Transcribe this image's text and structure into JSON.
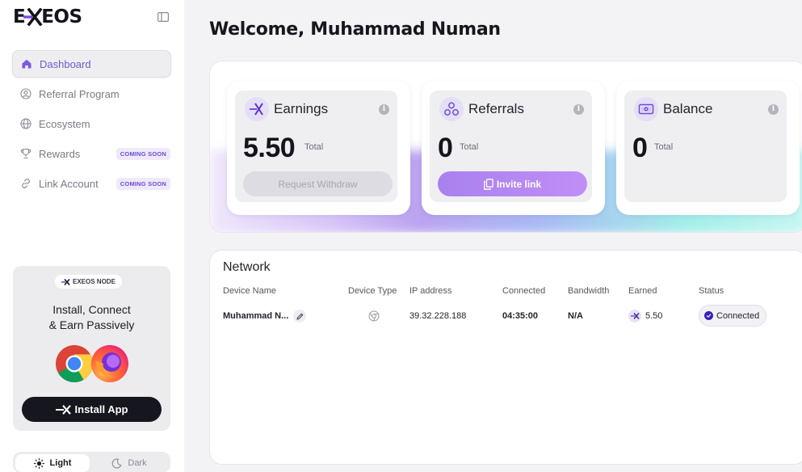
{
  "sidebar": {
    "logo": {
      "prefix": "E",
      "suffix": "EOS"
    },
    "items": [
      {
        "label": "Dashboard",
        "icon": "home-icon",
        "active": true
      },
      {
        "label": "Referral Program",
        "icon": "user-circle-icon"
      },
      {
        "label": "Ecosystem",
        "icon": "globe-icon"
      },
      {
        "label": "Rewards",
        "icon": "trophy-icon",
        "badge": "COMING SOON"
      },
      {
        "label": "Link Account",
        "icon": "link-icon",
        "badge": "COMING SOON"
      }
    ],
    "promo": {
      "badge": "EXEOS NODE",
      "headline_line1": "Install, Connect",
      "headline_line2": "& Earn Passively",
      "browsers": [
        "chrome-icon",
        "firefox-icon"
      ],
      "button": "Install App"
    },
    "theme": {
      "light": "Light",
      "dark": "Dark",
      "selected": "Light"
    }
  },
  "header": {
    "welcome": "Welcome, Muhammad Numan"
  },
  "stats": [
    {
      "title": "Earnings",
      "value": "5.50",
      "unit": "Total",
      "button": "Request Withdraw",
      "button_state": "disabled",
      "icon": "exeos-x-icon"
    },
    {
      "title": "Referrals",
      "value": "0",
      "unit": "Total",
      "button": "Invite link",
      "button_state": "enabled",
      "icon": "referrals-icon"
    },
    {
      "title": "Balance",
      "value": "0",
      "unit": "Total",
      "icon": "wallet-icon"
    }
  ],
  "network": {
    "title": "Network",
    "columns": [
      "Device Name",
      "Device Type",
      "IP address",
      "Connected",
      "Bandwidth",
      "Earned",
      "Status"
    ],
    "rows": [
      {
        "device_name": "Muhammad N...",
        "device_type": "chrome-icon",
        "ip": "39.32.228.188",
        "connected": "04:35:00",
        "bandwidth": "N/A",
        "earned": "5.50",
        "status": "Connected"
      }
    ]
  },
  "colors": {
    "accent": "#6d5bd0",
    "status_dot": "#3a1fb8",
    "dark_button": "#16161e"
  }
}
